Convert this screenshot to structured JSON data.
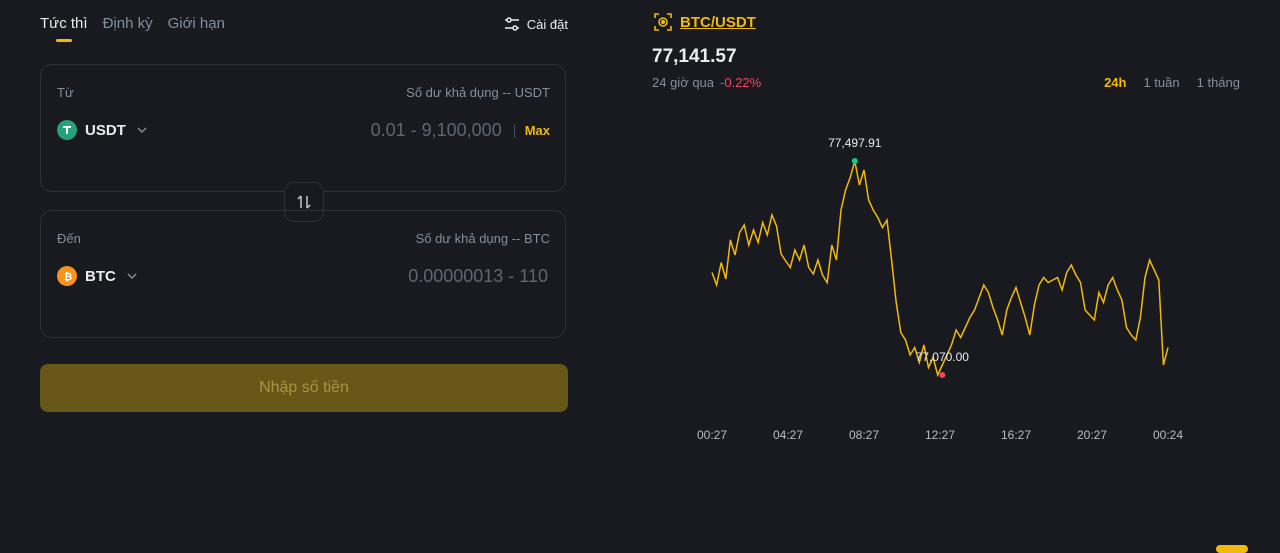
{
  "tabs": [
    {
      "label": "Tức thì",
      "active": true
    },
    {
      "label": "Định kỳ",
      "active": false
    },
    {
      "label": "Giới hạn",
      "active": false
    }
  ],
  "settings": {
    "label": "Cài đặt",
    "icon": "sliders-icon"
  },
  "from": {
    "label": "Từ",
    "balance": "Số dư khả dụng -- USDT",
    "coin": "USDT",
    "coin_color": "#26a17b",
    "placeholder": "0.01 - 9,100,000",
    "max_label": "Max"
  },
  "to": {
    "label": "Đến",
    "balance": "Số dư khả dụng -- BTC",
    "coin": "BTC",
    "coin_color": "#f7931a",
    "placeholder": "0.00000013 - 110"
  },
  "swap_icon": "swap-vertical-icon",
  "cta_label": "Nhập số tiền",
  "market": {
    "pair": "BTC/USDT",
    "price": "77,141.57",
    "change_label": "24 giờ qua",
    "change_pct": "-0.22%",
    "ranges": [
      {
        "label": "24h",
        "active": true
      },
      {
        "label": "1 tuần",
        "active": false
      },
      {
        "label": "1 tháng",
        "active": false
      }
    ]
  },
  "chart_data": {
    "type": "line",
    "x_ticks": [
      "00:27",
      "04:27",
      "08:27",
      "12:27",
      "16:27",
      "20:27",
      "00:24"
    ],
    "high": {
      "label": "77,497.91",
      "value": 77497.91,
      "t": 0.31
    },
    "low": {
      "label": "77,070.00",
      "value": 77070.0,
      "t": 0.51
    },
    "ylim": [
      77050,
      77520
    ],
    "line_color": "#f0b90b",
    "high_color": "#0ecb81",
    "low_color": "#f6465d",
    "values": [
      77275,
      77250,
      77295,
      77262,
      77340,
      77310,
      77355,
      77370,
      77330,
      77360,
      77335,
      77375,
      77350,
      77390,
      77368,
      77312,
      77298,
      77285,
      77320,
      77300,
      77330,
      77285,
      77272,
      77300,
      77270,
      77255,
      77330,
      77300,
      77400,
      77440,
      77465,
      77497.91,
      77450,
      77480,
      77420,
      77400,
      77385,
      77365,
      77380,
      77300,
      77215,
      77155,
      77140,
      77110,
      77125,
      77095,
      77130,
      77085,
      77105,
      77070,
      77090,
      77110,
      77130,
      77160,
      77145,
      77165,
      77185,
      77200,
      77225,
      77250,
      77235,
      77205,
      77180,
      77150,
      77200,
      77225,
      77245,
      77215,
      77185,
      77150,
      77210,
      77250,
      77265,
      77255,
      77260,
      77265,
      77240,
      77275,
      77290,
      77270,
      77255,
      77200,
      77190,
      77180,
      77235,
      77215,
      77250,
      77265,
      77240,
      77220,
      77165,
      77150,
      77140,
      77185,
      77265,
      77300,
      77280,
      77260,
      77090,
      77125
    ]
  }
}
